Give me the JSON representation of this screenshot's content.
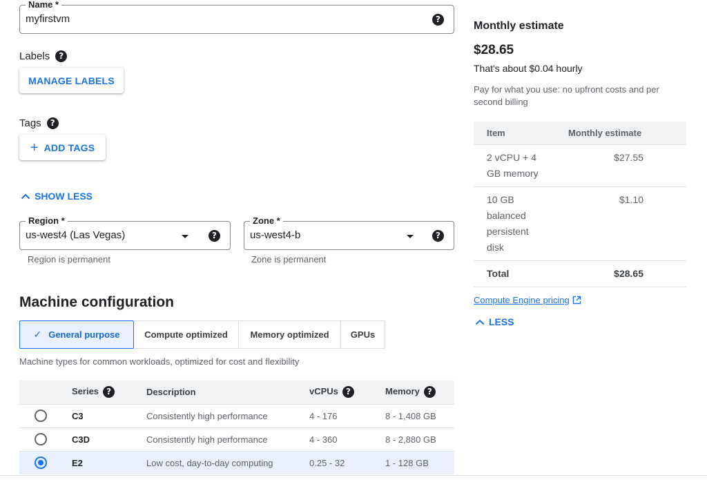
{
  "name_field": {
    "label": "Name *",
    "value": "myfirstvm"
  },
  "labels": {
    "title": "Labels",
    "button": "MANAGE LABELS"
  },
  "tags": {
    "title": "Tags",
    "button": "ADD TAGS"
  },
  "show_less": "SHOW LESS",
  "region": {
    "label": "Region *",
    "value": "us-west4 (Las Vegas)",
    "hint": "Region is permanent"
  },
  "zone": {
    "label": "Zone *",
    "value": "us-west4-b",
    "hint": "Zone is permanent"
  },
  "machine_config": {
    "title": "Machine configuration",
    "tabs": [
      "General purpose",
      "Compute optimized",
      "Memory optimized",
      "GPUs"
    ],
    "active_tab": "General purpose",
    "description": "Machine types for common workloads, optimized for cost and flexibility",
    "columns": [
      "Series",
      "Description",
      "vCPUs",
      "Memory"
    ],
    "rows": [
      {
        "series": "C3",
        "description": "Consistently high performance",
        "vcpus": "4 - 176",
        "memory": "8 - 1,408 GB",
        "selected": false
      },
      {
        "series": "C3D",
        "description": "Consistently high performance",
        "vcpus": "4 - 360",
        "memory": "8 - 2,880 GB",
        "selected": false
      },
      {
        "series": "E2",
        "description": "Low cost, day-to-day computing",
        "vcpus": "0.25 - 32",
        "memory": "1 - 128 GB",
        "selected": true
      }
    ]
  },
  "estimate": {
    "title": "Monthly estimate",
    "amount": "$28.65",
    "hourly": "That's about $0.04 hourly",
    "note": "Pay for what you use: no upfront costs and per second billing",
    "columns": [
      "Item",
      "Monthly estimate"
    ],
    "rows": [
      {
        "item": "2 vCPU + 4 GB memory",
        "amount": "$27.55"
      },
      {
        "item": "10 GB balanced persistent disk",
        "amount": "$1.10"
      }
    ],
    "total_label": "Total",
    "total_amount": "$28.65",
    "pricing_link": "Compute Engine pricing",
    "less": "LESS"
  },
  "colors": {
    "accent": "#1a73e8",
    "selected_bg": "#e8f0fe",
    "header_bg": "#f1f3f4"
  }
}
